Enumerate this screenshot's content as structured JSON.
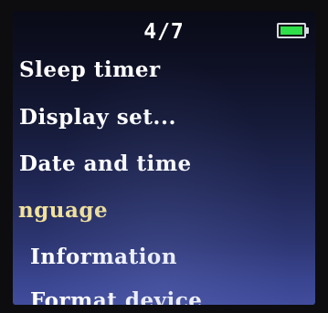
{
  "header": {
    "page_indicator": "4/7",
    "battery_icon": "battery-full-icon",
    "battery_color": "#2fe04a"
  },
  "menu": {
    "items": [
      {
        "label": "Sleep timer"
      },
      {
        "label": "Display set..."
      },
      {
        "label": "Date and time"
      },
      {
        "label": "nguage",
        "selected": true
      },
      {
        "label": "Information"
      },
      {
        "label": "Format device"
      }
    ],
    "selected_color": "#f3e39a",
    "text_color": "#ffffff"
  }
}
